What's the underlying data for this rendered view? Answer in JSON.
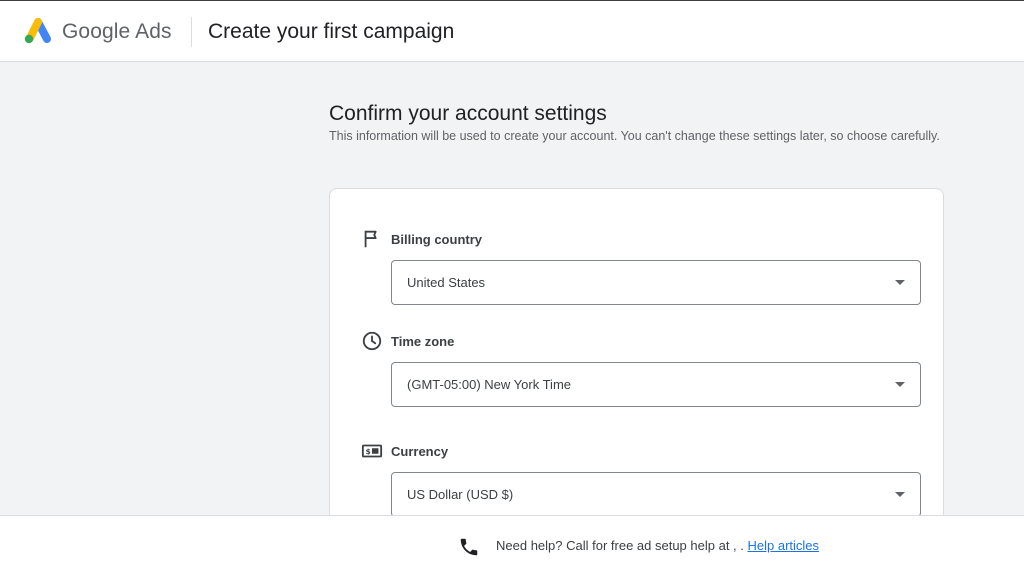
{
  "header": {
    "brand": "Google Ads",
    "title": "Create your first campaign"
  },
  "main": {
    "heading": "Confirm your account settings",
    "description": "This information will be used to create your account. You can't change these settings later, so choose carefully."
  },
  "fields": {
    "billing_country": {
      "label": "Billing country",
      "value": "United States",
      "icon": "flag-icon"
    },
    "time_zone": {
      "label": "Time zone",
      "value": "(GMT-05:00) New York Time",
      "icon": "clock-icon"
    },
    "currency": {
      "label": "Currency",
      "value": "US Dollar (USD $)",
      "icon": "currency-icon"
    }
  },
  "footer": {
    "help_text": "Need help? Call for free ad setup help at , . ",
    "help_link": "Help articles",
    "icon": "phone-icon"
  },
  "colors": {
    "logo_blue": "#4285f4",
    "logo_yellow": "#fbbc04",
    "logo_green": "#34a853",
    "link": "#1a73e8",
    "background": "#f1f3f4"
  }
}
